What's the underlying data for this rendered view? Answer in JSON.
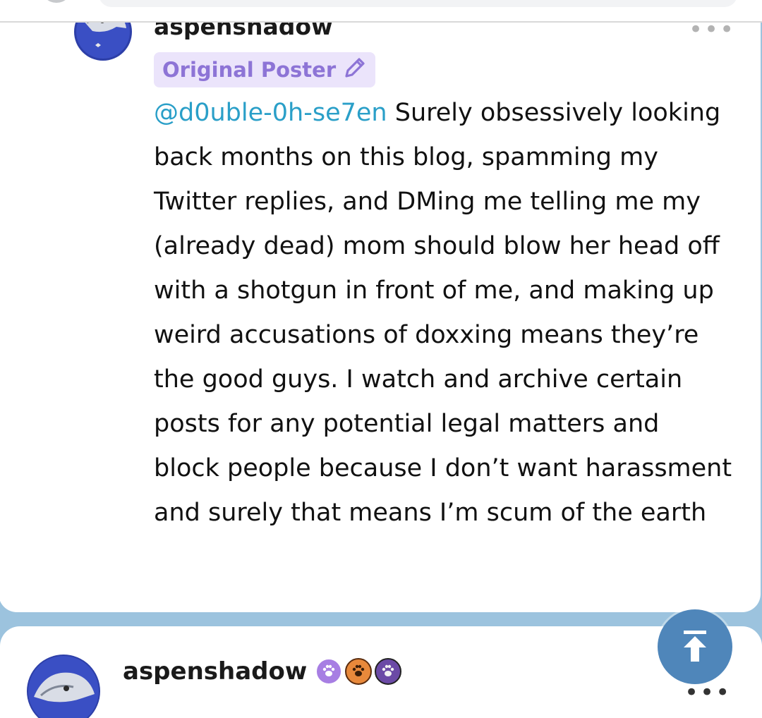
{
  "comments": [
    {
      "author": "aspenshadow",
      "badge": "Original Poster",
      "mention": "@d0uble-0h-se7en",
      "text": " Surely obsessively looking back months on this blog, spamming my Twitter replies, and DMing me telling me my (already dead) mom should blow her head off with a shotgun in front of me, and making up weird accusations of doxxing means they’re the good guys. I watch and archive certain posts for any potential legal matters and block people because I don’t want harassment and surely that means I’m scum of the earth",
      "more": "•••"
    },
    {
      "author": "aspenshadow",
      "emoji_badges": [
        "paw-purple",
        "paw-orange",
        "paw-black"
      ],
      "more": "•••"
    }
  ],
  "colors": {
    "mention": "#2a9fc8",
    "badge_text": "#8d74d6",
    "badge_bg": "#ebe4fb",
    "page_bg": "#9cc3de",
    "scroll_button": "#4f86ba"
  },
  "icons": [
    "pencil-icon",
    "arrow-up-to-top-icon",
    "more-icon"
  ]
}
